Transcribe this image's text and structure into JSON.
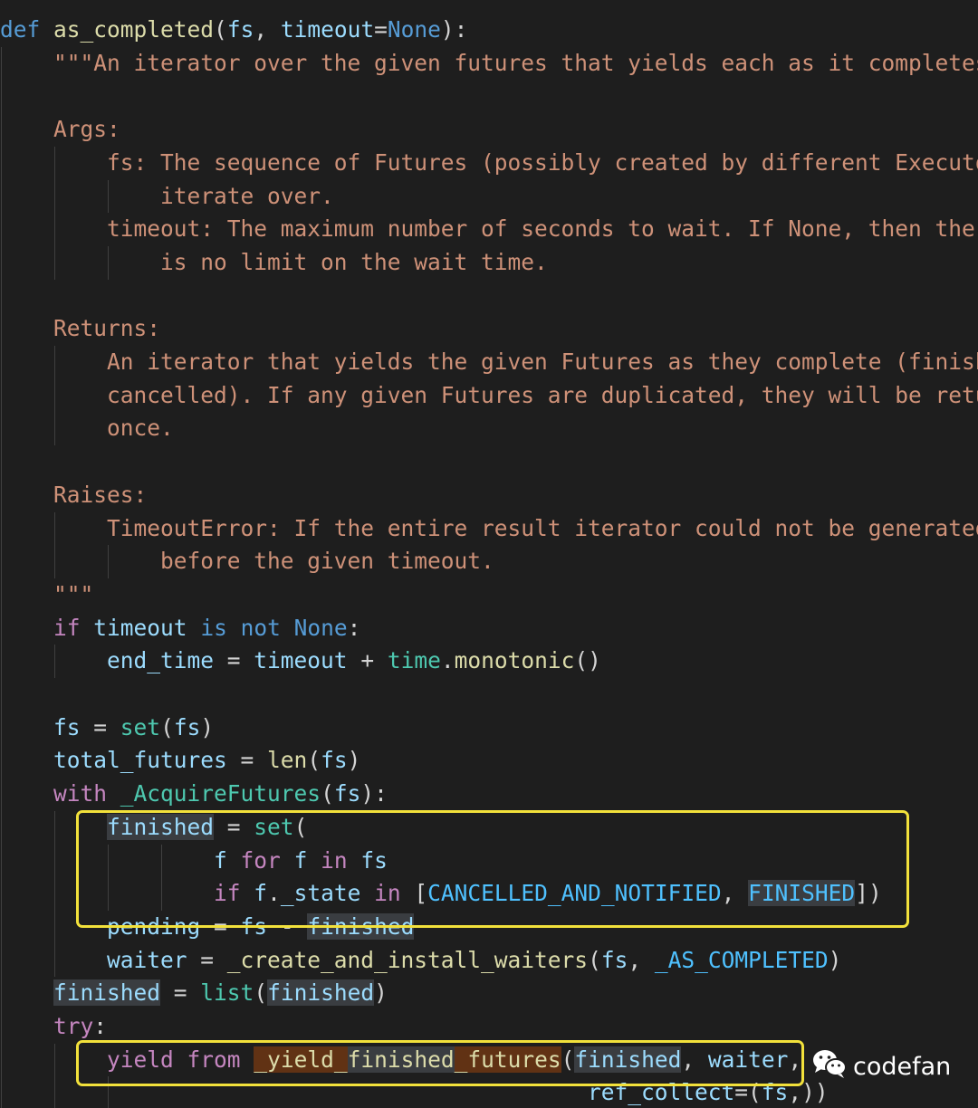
{
  "code": {
    "lines": [
      [
        {
          "t": "def",
          "c": "kb"
        },
        {
          "t": " ",
          "c": "p"
        },
        {
          "t": "as_completed",
          "c": "fn"
        },
        {
          "t": "(",
          "c": "p"
        },
        {
          "t": "fs",
          "c": "v"
        },
        {
          "t": ", ",
          "c": "p"
        },
        {
          "t": "timeout",
          "c": "v"
        },
        {
          "t": "=",
          "c": "p"
        },
        {
          "t": "None",
          "c": "kb"
        },
        {
          "t": "):",
          "c": "p"
        }
      ],
      [
        {
          "t": "    \"\"\"An iterator over the given futures that yields each as it completes.",
          "c": "s"
        }
      ],
      [],
      [
        {
          "t": "    Args:",
          "c": "s"
        }
      ],
      [
        {
          "t": "        fs: The sequence of Futures (possibly created by different Executors) to",
          "c": "s"
        }
      ],
      [
        {
          "t": "            iterate over.",
          "c": "s"
        }
      ],
      [
        {
          "t": "        timeout: The maximum number of seconds to wait. If None, then there",
          "c": "s"
        }
      ],
      [
        {
          "t": "            is no limit on the wait time.",
          "c": "s"
        }
      ],
      [],
      [
        {
          "t": "    Returns:",
          "c": "s"
        }
      ],
      [
        {
          "t": "        An iterator that yields the given Futures as they complete (finished or",
          "c": "s"
        }
      ],
      [
        {
          "t": "        cancelled). If any given Futures are duplicated, they will be returned",
          "c": "s"
        }
      ],
      [
        {
          "t": "        once.",
          "c": "s"
        }
      ],
      [],
      [
        {
          "t": "    Raises:",
          "c": "s"
        }
      ],
      [
        {
          "t": "        TimeoutError: If the entire result iterator could not be generated",
          "c": "s"
        }
      ],
      [
        {
          "t": "            before the given timeout.",
          "c": "s"
        }
      ],
      [
        {
          "t": "    \"\"\"",
          "c": "s"
        }
      ],
      [
        {
          "t": "    ",
          "c": "p"
        },
        {
          "t": "if",
          "c": "k"
        },
        {
          "t": " ",
          "c": "p"
        },
        {
          "t": "timeout",
          "c": "v"
        },
        {
          "t": " ",
          "c": "p"
        },
        {
          "t": "is",
          "c": "kb"
        },
        {
          "t": " ",
          "c": "p"
        },
        {
          "t": "not",
          "c": "kb"
        },
        {
          "t": " ",
          "c": "p"
        },
        {
          "t": "None",
          "c": "kb"
        },
        {
          "t": ":",
          "c": "p"
        }
      ],
      [
        {
          "t": "        ",
          "c": "p"
        },
        {
          "t": "end_time",
          "c": "v"
        },
        {
          "t": " = ",
          "c": "p"
        },
        {
          "t": "timeout",
          "c": "v"
        },
        {
          "t": " + ",
          "c": "p"
        },
        {
          "t": "time",
          "c": "bi"
        },
        {
          "t": ".",
          "c": "p"
        },
        {
          "t": "monotonic",
          "c": "fn"
        },
        {
          "t": "()",
          "c": "p"
        }
      ],
      [],
      [
        {
          "t": "    ",
          "c": "p"
        },
        {
          "t": "fs",
          "c": "v"
        },
        {
          "t": " = ",
          "c": "p"
        },
        {
          "t": "set",
          "c": "bi"
        },
        {
          "t": "(",
          "c": "p"
        },
        {
          "t": "fs",
          "c": "v"
        },
        {
          "t": ")",
          "c": "p"
        }
      ],
      [
        {
          "t": "    ",
          "c": "p"
        },
        {
          "t": "total_futures",
          "c": "v"
        },
        {
          "t": " = ",
          "c": "p"
        },
        {
          "t": "len",
          "c": "fn"
        },
        {
          "t": "(",
          "c": "p"
        },
        {
          "t": "fs",
          "c": "v"
        },
        {
          "t": ")",
          "c": "p"
        }
      ],
      [
        {
          "t": "    ",
          "c": "p"
        },
        {
          "t": "with",
          "c": "k"
        },
        {
          "t": " ",
          "c": "p"
        },
        {
          "t": "_AcquireFutures",
          "c": "bi"
        },
        {
          "t": "(",
          "c": "p"
        },
        {
          "t": "fs",
          "c": "v"
        },
        {
          "t": "):",
          "c": "p"
        }
      ],
      [
        {
          "t": "        ",
          "c": "p"
        },
        {
          "t": "finished",
          "c": "v hl"
        },
        {
          "t": " = ",
          "c": "p"
        },
        {
          "t": "set",
          "c": "bi"
        },
        {
          "t": "(",
          "c": "p"
        }
      ],
      [
        {
          "t": "                ",
          "c": "p"
        },
        {
          "t": "f",
          "c": "v"
        },
        {
          "t": " ",
          "c": "p"
        },
        {
          "t": "for",
          "c": "k"
        },
        {
          "t": " ",
          "c": "p"
        },
        {
          "t": "f",
          "c": "v"
        },
        {
          "t": " ",
          "c": "p"
        },
        {
          "t": "in",
          "c": "k"
        },
        {
          "t": " ",
          "c": "p"
        },
        {
          "t": "fs",
          "c": "v"
        }
      ],
      [
        {
          "t": "                ",
          "c": "p"
        },
        {
          "t": "if",
          "c": "k"
        },
        {
          "t": " ",
          "c": "p"
        },
        {
          "t": "f",
          "c": "v"
        },
        {
          "t": ".",
          "c": "p"
        },
        {
          "t": "_state",
          "c": "v"
        },
        {
          "t": " ",
          "c": "p"
        },
        {
          "t": "in",
          "c": "k"
        },
        {
          "t": " [",
          "c": "p"
        },
        {
          "t": "CANCELLED_AND_NOTIFIED",
          "c": "c"
        },
        {
          "t": ", ",
          "c": "p"
        },
        {
          "t": "FINISHED",
          "c": "c hl"
        },
        {
          "t": "])",
          "c": "p"
        }
      ],
      [
        {
          "t": "        ",
          "c": "p"
        },
        {
          "t": "pending",
          "c": "v"
        },
        {
          "t": " = ",
          "c": "p"
        },
        {
          "t": "fs",
          "c": "v"
        },
        {
          "t": " - ",
          "c": "p"
        },
        {
          "t": "finished",
          "c": "v hl"
        }
      ],
      [
        {
          "t": "        ",
          "c": "p"
        },
        {
          "t": "waiter",
          "c": "v"
        },
        {
          "t": " = ",
          "c": "p"
        },
        {
          "t": "_create_and_install_waiters",
          "c": "fn"
        },
        {
          "t": "(",
          "c": "p"
        },
        {
          "t": "fs",
          "c": "v"
        },
        {
          "t": ", ",
          "c": "p"
        },
        {
          "t": "_AS_COMPLETED",
          "c": "c"
        },
        {
          "t": ")",
          "c": "p"
        }
      ],
      [
        {
          "t": "    ",
          "c": "p"
        },
        {
          "t": "finished",
          "c": "v hl"
        },
        {
          "t": " = ",
          "c": "p"
        },
        {
          "t": "list",
          "c": "bi"
        },
        {
          "t": "(",
          "c": "p"
        },
        {
          "t": "finished",
          "c": "v hl"
        },
        {
          "t": ")",
          "c": "p"
        }
      ],
      [
        {
          "t": "    ",
          "c": "p"
        },
        {
          "t": "try",
          "c": "k"
        },
        {
          "t": ":",
          "c": "p"
        }
      ],
      [
        {
          "t": "        ",
          "c": "p"
        },
        {
          "t": "yield",
          "c": "k"
        },
        {
          "t": " ",
          "c": "p"
        },
        {
          "t": "from",
          "c": "k"
        },
        {
          "t": " ",
          "c": "p"
        },
        {
          "t": "_yield_",
          "c": "fn hl2"
        },
        {
          "t": "finished",
          "c": "fn hl"
        },
        {
          "t": "_futures",
          "c": "fn hl2"
        },
        {
          "t": "(",
          "c": "p"
        },
        {
          "t": "finished",
          "c": "v hl"
        },
        {
          "t": ", ",
          "c": "p"
        },
        {
          "t": "waiter",
          "c": "v"
        },
        {
          "t": ",",
          "c": "p"
        }
      ],
      [
        {
          "t": "                                            ",
          "c": "p"
        },
        {
          "t": "ref_collect",
          "c": "v"
        },
        {
          "t": "=(",
          "c": "p"
        },
        {
          "t": "fs",
          "c": "v"
        },
        {
          "t": ",))",
          "c": "p"
        }
      ]
    ]
  },
  "watermark": {
    "label": "codefan",
    "icon": "wechat-icon"
  },
  "colors": {
    "background": "#1e1e1e",
    "highlight_box": "#f2e13b",
    "keyword_control": "#c586c0",
    "keyword_storage": "#569cd6",
    "function": "#dcdcaa",
    "variable": "#9cdcfe",
    "string": "#ce9178",
    "constant": "#4fc1ff",
    "class": "#4ec9b0"
  }
}
